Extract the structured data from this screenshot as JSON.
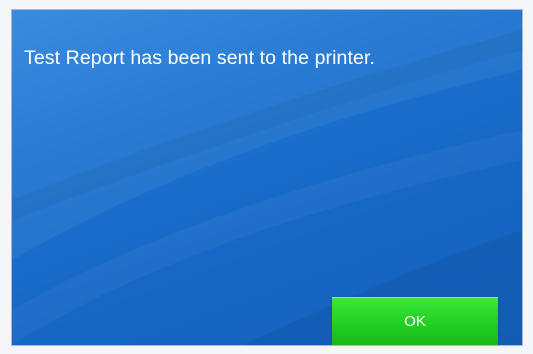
{
  "dialog": {
    "message": "Test Report has been sent to the printer.",
    "ok_label": "OK"
  },
  "colors": {
    "dialog_background": "#1c6fcf",
    "ok_button": "#22cf22",
    "text": "#ffffff"
  }
}
